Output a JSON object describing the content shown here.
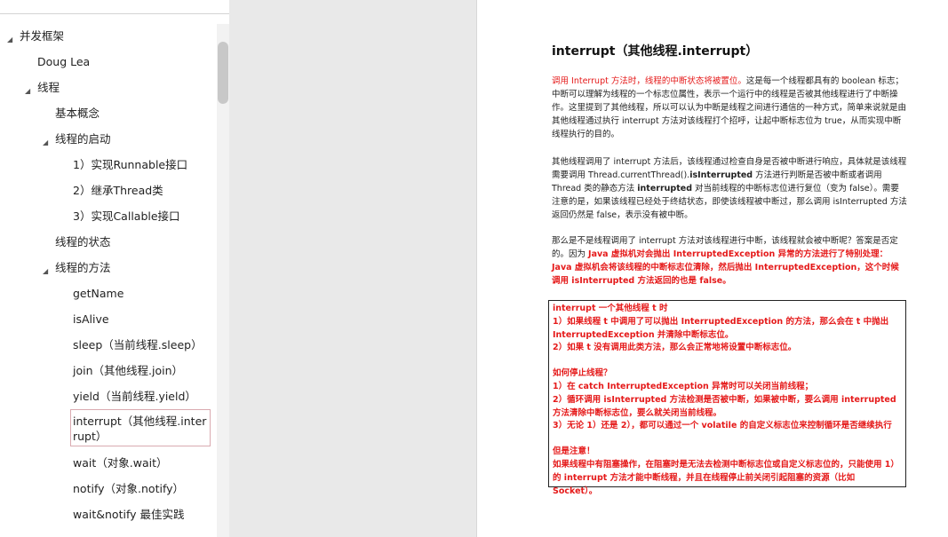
{
  "outline": {
    "items": [
      {
        "label": "并发框架"
      },
      {
        "label": "Doug Lea"
      },
      {
        "label": "线程"
      },
      {
        "label": "基本概念"
      },
      {
        "label": "线程的启动"
      },
      {
        "label": "1）实现Runnable接口"
      },
      {
        "label": "2）继承Thread类"
      },
      {
        "label": "3）实现Callable接口"
      },
      {
        "label": "线程的状态"
      },
      {
        "label": "线程的方法"
      },
      {
        "label": "getName"
      },
      {
        "label": "isAlive"
      },
      {
        "label": "sleep（当前线程.sleep）"
      },
      {
        "label": "join（其他线程.join）"
      },
      {
        "label": "yield（当前线程.yield）"
      },
      {
        "label": "interrupt（其他线程.interrupt）"
      },
      {
        "label": "wait（对象.wait）"
      },
      {
        "label": "notify（对象.notify）"
      },
      {
        "label": "wait&notify 最佳实践"
      }
    ],
    "selected_index": 15
  },
  "document": {
    "title": "interrupt（其他线程.interrupt）",
    "p1_red": "调用 Interrupt 方法时，线程的中断状态将被置位。",
    "p1_rest": "这是每一个线程都具有的 boolean 标志；中断可以理解为线程的一个标志位属性，表示一个运行中的线程是否被其他线程进行了中断操作。这里提到了其他线程，所以可以认为中断是线程之间进行通信的一种方式，简单来说就是由其他线程通过执行 interrupt 方法对该线程打个招呼，让起中断标志位为 true，从而实现中断线程执行的目的。",
    "p2_a": "其他线程调用了 interrupt 方法后，该线程通过检查自身是否被中断进行响应，具体就是该线程需要调用 Thread.currentThread().",
    "p2_b": "isInterrupted",
    "p2_c": " 方法进行判断是否被中断或者调用 Thread 类的静态方法 ",
    "p2_d": "interrupted",
    "p2_e": " 对当前线程的中断标志位进行复位（变为 false）。需要注意的是，如果该线程已经处于终结状态，即使该线程被中断过，那么调用 isInterrupted 方法返回仍然是 false，表示没有被中断。",
    "p3_a": "那么是不是线程调用了 interrupt 方法对该线程进行中断，该线程就会被中断呢？答案是否定的。因为 ",
    "p3_b": "Java 虚拟机对会抛出 InterruptedException 异常的方法进行了特别处理：Java 虚拟机会将该线程的中断标志位清除，然后抛出 InterruptedException，这个时候调用 isInterrupted 方法返回的也是 false。",
    "box_lines": [
      "interrupt 一个其他线程 t 时",
      "1）如果线程 t 中调用了可以抛出 InterruptedException 的方法，那么会在 t 中抛出 InterruptedException 并清除中断标志位。",
      "2）如果 t 没有调用此类方法，那么会正常地将设置中断标志位。",
      "",
      "如何停止线程？",
      "1）在 catch InterruptedException 异常时可以关闭当前线程；",
      "2）循环调用 isInterrupted 方法检测是否被中断，如果被中断，要么调用 interrupted 方法清除中断标志位，要么就关闭当前线程。",
      "3）无论 1）还是 2），都可以通过一个 volatile 的自定义标志位来控制循环是否继续执行",
      "",
      "但是注意！",
      "如果线程中有阻塞操作，在阻塞时是无法去检测中断标志位或自定义标志位的，只能使用 1）的 interrupt 方法才能中断线程，并且在线程停止前关闭引起阻塞的资源（比如 Socket）。"
    ]
  }
}
